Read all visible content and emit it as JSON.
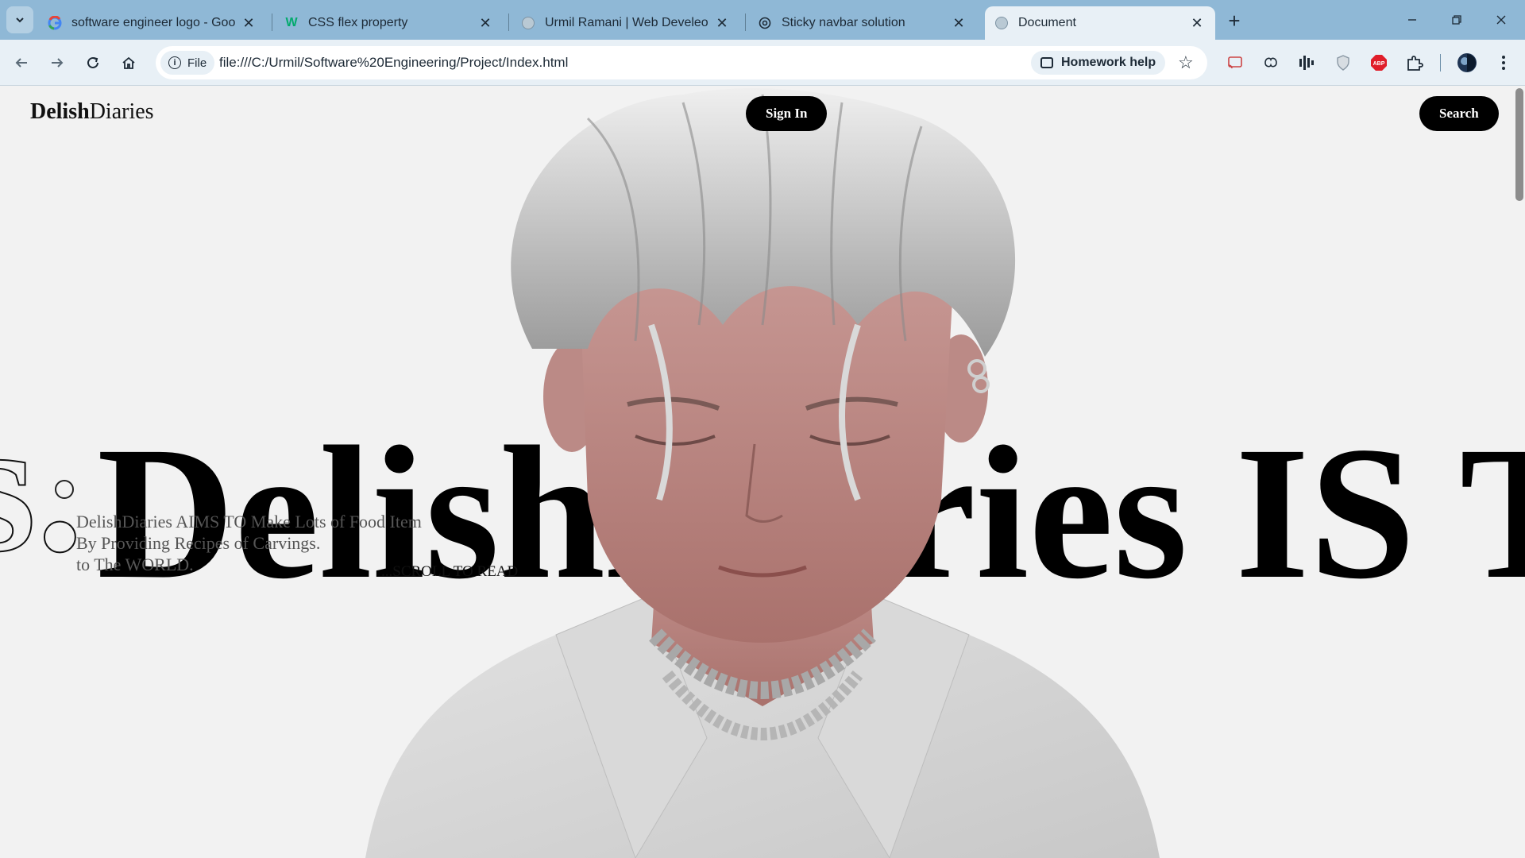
{
  "browser": {
    "tabs": [
      {
        "title": "software engineer logo - Googl",
        "icon": "google-icon"
      },
      {
        "title": "CSS flex property",
        "icon": "w3schools-icon"
      },
      {
        "title": "Urmil Ramani | Web Develeoper",
        "icon": "globe-icon"
      },
      {
        "title": "Sticky navbar solution",
        "icon": "chatgpt-icon"
      },
      {
        "title": "Document",
        "icon": "globe-icon",
        "active": true
      }
    ],
    "address": {
      "scheme_label": "File",
      "url": "file:///C:/Urmil/Software%20Engineering/Project/Index.html"
    },
    "homework_help_label": "Homework help",
    "extensions": [
      "cast-icon",
      "brain-icon",
      "equalizer-icon",
      "shield-icon",
      "abp-icon",
      "puzzle-icon",
      "profile-avatar"
    ]
  },
  "site": {
    "logo": {
      "bold": "Delish",
      "regular": "Diaries"
    },
    "signin_label": "Sign In",
    "search_label": "Search",
    "hero": {
      "outline_text": "s.",
      "main_text": "DelishDiaries IS T"
    },
    "subtext": {
      "line1": "DelishDiaries AIMS TO Make Lots of Food Item",
      "line2": "By Providing Recipes of Carvings.",
      "line3": "to The WORLD."
    },
    "scroll_label": "...SCROLL TO READ"
  }
}
